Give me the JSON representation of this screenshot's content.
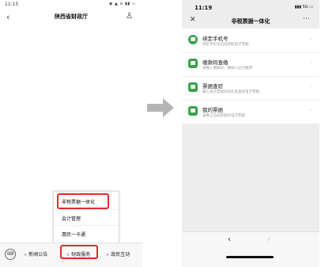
{
  "left": {
    "status_time": "11:15",
    "status_icons": "◉ ▲ ≋ ▮▮ ▭",
    "back_icon": "‹",
    "title": "陕西省财政厅",
    "user_icon": "♙",
    "popup_items": [
      "非税票据一体化",
      "会计管理",
      "惠民一卡通"
    ],
    "keyboard_icon": "⌨",
    "menus": [
      "新闻公告",
      "财政服务",
      "政民互动"
    ],
    "menu_dot": "≡"
  },
  "right": {
    "status_time": "11:19",
    "status_icons": "▮▮▮ 5G ▭",
    "close_icon": "✕",
    "title": "非税票据一体化",
    "more_icon": "⋯",
    "rows": [
      {
        "title": "绑定手机号",
        "subtitle": "绑定手机号自动获取电子票据",
        "icon": "phone-icon"
      },
      {
        "title": "缴款码查缴",
        "subtitle": "请输入缴款码，缴纳人应付缴费",
        "icon": "code-icon"
      },
      {
        "title": "票据查验",
        "subtitle": "输入电子票据校验信息查验电子票据",
        "icon": "check-icon"
      },
      {
        "title": "我的票据",
        "subtitle": "查看已自动获取的电子票据",
        "icon": "receipt-icon"
      }
    ],
    "chevron": "›",
    "nav_back": "‹",
    "nav_forward": "›"
  },
  "colors": {
    "highlight": "#e02b2b",
    "icon_green": "#3aa24b",
    "arrow": "#b5b5b5"
  }
}
